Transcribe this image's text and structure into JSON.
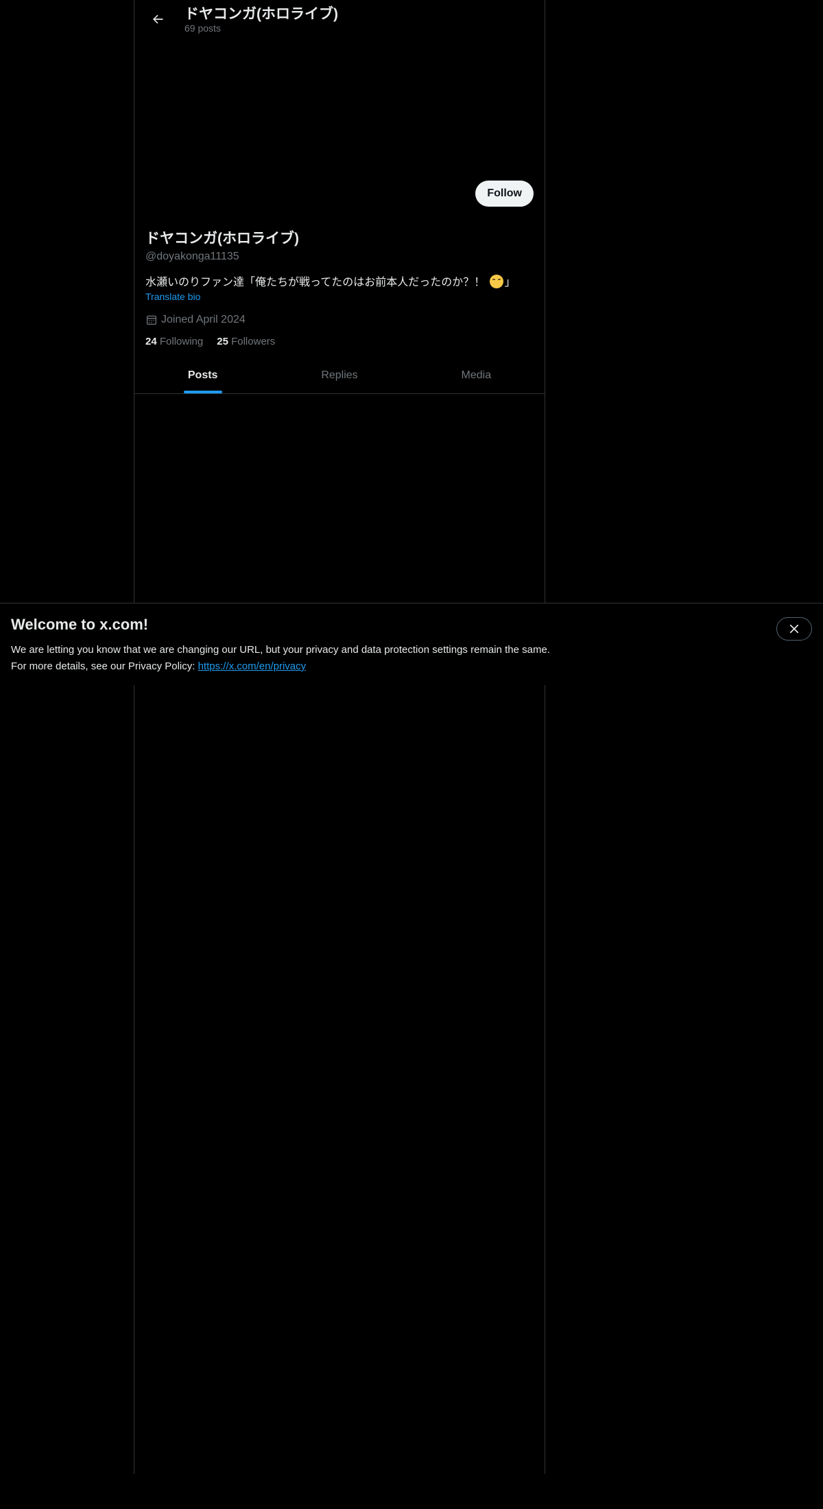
{
  "header": {
    "title": "ドヤコンガ(ホロライブ)",
    "posts_count": "69 posts"
  },
  "profile": {
    "display_name": "ドヤコンガ(ホロライブ)",
    "handle": "@doyakonga11135",
    "bio_before_emoji": "水瀬いのりファン達「俺たちが戦ってたのはお前本人だったのか？！ ",
    "bio_after_emoji": "」",
    "translate_label": "Translate bio",
    "joined": "Joined April 2024",
    "following_count": "24",
    "following_label": "Following",
    "followers_count": "25",
    "followers_label": "Followers",
    "follow_label": "Follow"
  },
  "tabs": [
    {
      "label": "Posts",
      "active": true
    },
    {
      "label": "Replies",
      "active": false
    },
    {
      "label": "Media",
      "active": false
    }
  ],
  "notice": {
    "title": "Welcome to x.com!",
    "line1": "We are letting you know that we are changing our URL, but your privacy and data protection settings remain the same.",
    "line2_prefix": "For more details, see our Privacy Policy: ",
    "link": "https://x.com/en/privacy"
  },
  "colors": {
    "background": "#000000",
    "accent": "#1d9bf0",
    "muted": "#71767b",
    "text": "#e7e9ea",
    "border": "#2f3336"
  }
}
